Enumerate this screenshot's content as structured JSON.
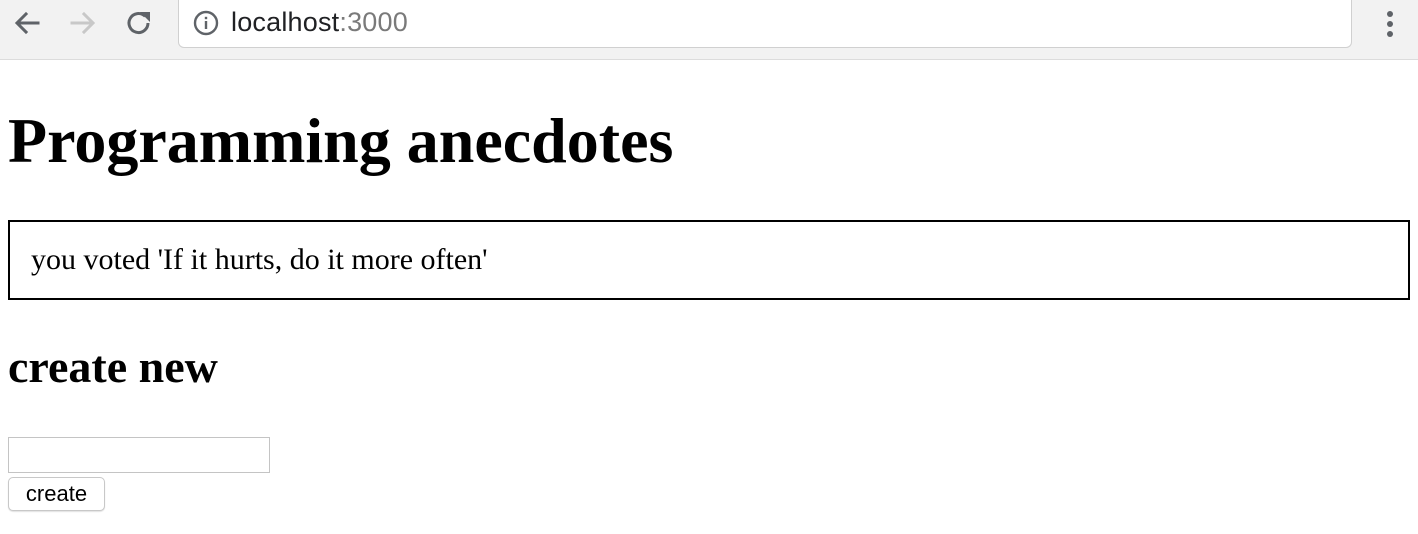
{
  "browser": {
    "url_host": "localhost",
    "url_port": ":3000",
    "icons": {
      "back": "arrow-left-icon",
      "forward": "arrow-right-icon",
      "reload": "reload-icon",
      "info": "info-icon",
      "menu": "kebab-menu-icon"
    }
  },
  "page": {
    "title": "Programming anecdotes",
    "notification": "you voted 'If it hurts, do it more often'",
    "form": {
      "heading": "create new",
      "input_value": "",
      "submit_label": "create"
    }
  }
}
